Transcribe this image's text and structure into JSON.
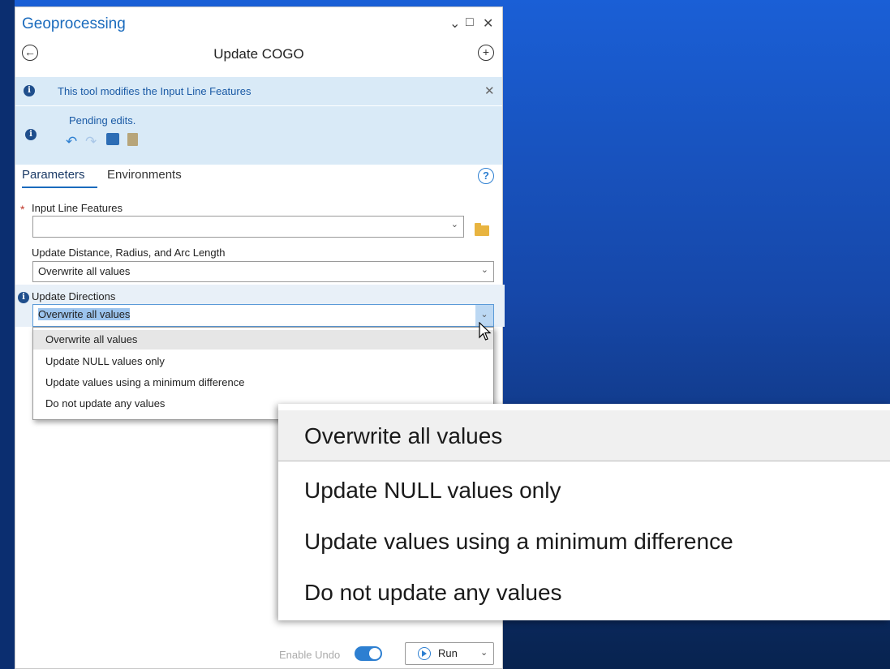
{
  "panel": {
    "title": "Geoprocessing",
    "window_controls": [
      "⌄",
      "□",
      "✕"
    ],
    "tool_title": "Update COGO",
    "back_icon": "←",
    "add_icon": "+"
  },
  "banner": {
    "message": "This tool modifies the Input Line Features",
    "close": "✕",
    "pending": "Pending edits.",
    "edit_icons": [
      "undo-icon",
      "redo-icon",
      "save-edits-icon",
      "discard-edits-icon"
    ]
  },
  "tabs": {
    "parameters": "Parameters",
    "environments": "Environments",
    "help": "?"
  },
  "params": {
    "input_line_label": "Input Line Features",
    "input_line_value": "",
    "required_mark": "*",
    "distance_label": "Update Distance, Radius, and Arc Length",
    "distance_value": "Overwrite all values",
    "directions_label": "Update Directions",
    "directions_value": "Overwrite all values"
  },
  "dropdown": {
    "options": [
      "Overwrite all values",
      "Update NULL values only",
      "Update values using a minimum difference",
      "Do not update any values"
    ],
    "selected_index": 0
  },
  "footer": {
    "enable_undo": "Enable Undo",
    "undo_on": true,
    "run": "Run"
  },
  "colors": {
    "accent": "#1a6bbd",
    "banner_bg": "#d9eaf7",
    "background": "#1a5fd6"
  }
}
